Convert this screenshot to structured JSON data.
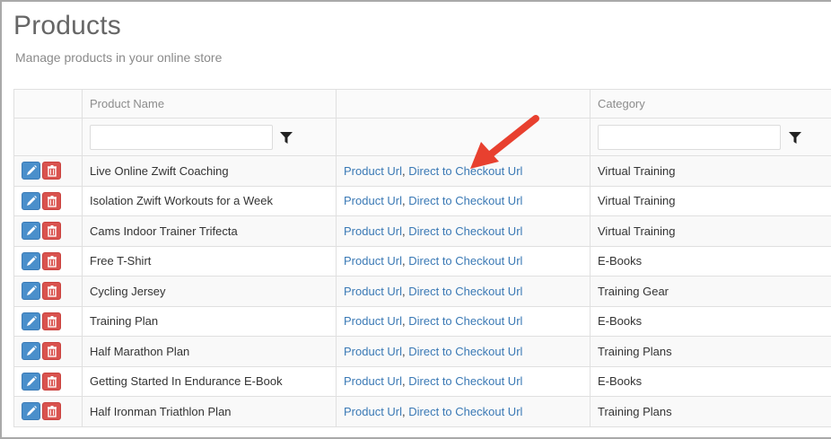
{
  "page": {
    "title": "Products",
    "subtitle": "Manage products in your online store"
  },
  "table": {
    "columns": [
      "",
      "Product Name",
      "",
      "Category"
    ],
    "link_labels": {
      "product_url": "Product Url",
      "separator": ", ",
      "checkout_url": "Direct to Checkout Url"
    },
    "filters": {
      "product_name": "",
      "category": ""
    },
    "rows": [
      {
        "name": "Live Online Zwift Coaching",
        "category": "Virtual Training"
      },
      {
        "name": "Isolation Zwift Workouts for a Week",
        "category": "Virtual Training"
      },
      {
        "name": "Cams Indoor Trainer Trifecta",
        "category": "Virtual Training"
      },
      {
        "name": "Free T-Shirt",
        "category": "E-Books"
      },
      {
        "name": "Cycling Jersey",
        "category": "Training Gear"
      },
      {
        "name": "Training Plan",
        "category": "E-Books"
      },
      {
        "name": "Half Marathon Plan",
        "category": "Training Plans"
      },
      {
        "name": "Getting Started In Endurance E-Book",
        "category": "E-Books"
      },
      {
        "name": "Half Ironman Triathlon Plan",
        "category": "Training Plans"
      }
    ]
  },
  "colors": {
    "accent": "#3a79b5",
    "edit": "#4a8fcb",
    "delete": "#d9534f",
    "annotation_arrow": "#e8402f"
  },
  "icons": {
    "edit": "pencil-icon",
    "delete": "trash-icon",
    "filter": "funnel-icon",
    "annotation": "red-arrow-icon"
  }
}
